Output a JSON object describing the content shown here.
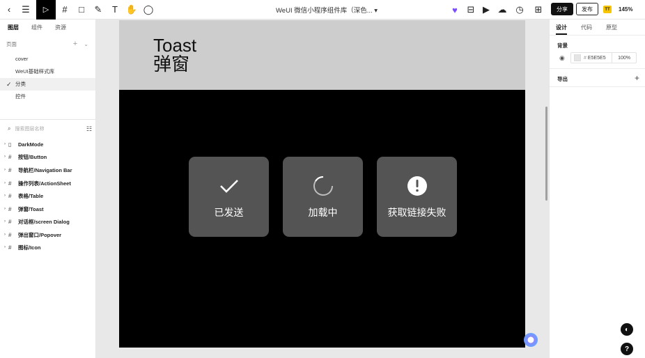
{
  "topbar": {
    "title": "WeUI 微信小程序组件库（深色...",
    "share_label": "分享",
    "publish_label": "发布",
    "zoom": "145%",
    "badge": "TT"
  },
  "left": {
    "tabs": [
      "图层",
      "组件",
      "资源"
    ],
    "pages_label": "页面",
    "pages": [
      "cover",
      "WeUI基础样式库",
      "分类",
      "控件"
    ],
    "selected_page": "分类",
    "search_placeholder": "搜索图层名称",
    "layers": [
      "DarkMode",
      "按钮/Button",
      "导航栏/Navigation Bar",
      "操作列表/ActionSheet",
      "表格/Table",
      "弹窗/Toast",
      "对话框/screen Dialog",
      "弹出窗口/Popover",
      "图标/Icon"
    ]
  },
  "canvas": {
    "heading_line1": "Toast",
    "heading_line2": "弹窗",
    "toasts": [
      {
        "label": "已发送",
        "icon": "check-icon"
      },
      {
        "label": "加载中",
        "icon": "loading-spinner-icon"
      },
      {
        "label": "获取链接失败",
        "icon": "warning-icon"
      }
    ]
  },
  "right": {
    "tabs": [
      "设计",
      "代码",
      "原型"
    ],
    "background_label": "背景",
    "bg_hex": "E5E5E5",
    "bg_opacity": "100%",
    "export_label": "导出"
  },
  "colors": {
    "frame_bg": "#000000",
    "toast_bg": "#545454",
    "header_bg": "#cdcdcd"
  }
}
